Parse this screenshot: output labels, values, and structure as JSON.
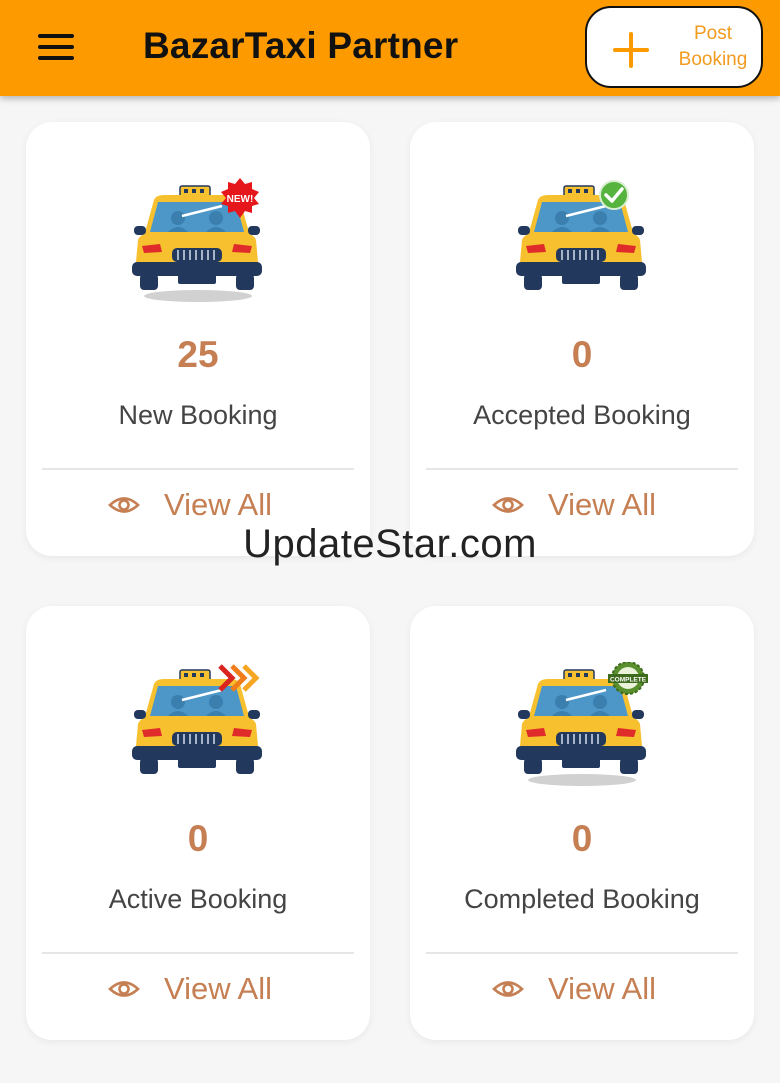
{
  "appbar": {
    "title": "BazarTaxi Partner",
    "post_button": {
      "line1": "Post",
      "line2": "Booking"
    }
  },
  "cards": [
    {
      "count": "25",
      "label": "New Booking",
      "view_all": "View All",
      "badge": "NEW!"
    },
    {
      "count": "0",
      "label": "Accepted Booking",
      "view_all": "View All",
      "badge": "check-icon"
    },
    {
      "count": "0",
      "label": "Active Booking",
      "view_all": "View All",
      "badge": "chevrons-icon"
    },
    {
      "count": "0",
      "label": "Completed Booking",
      "view_all": "View All",
      "badge": "COMPLETE"
    }
  ],
  "watermark": "UpdateStar.com",
  "colors": {
    "appbar": "#fd9a00",
    "accent_text": "#c57f53",
    "taxi_yellow": "#f6c02f",
    "taxi_navy": "#22385c"
  }
}
